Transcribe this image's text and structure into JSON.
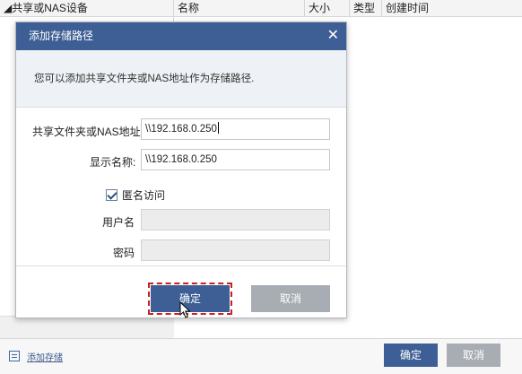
{
  "background": {
    "columns": [
      "◢共享或NAS设备",
      "名称",
      "大小",
      "类型",
      "创建时间"
    ],
    "add_storage_label": "添加存储",
    "ok_label": "确定",
    "cancel_label": "取消"
  },
  "dialog": {
    "title": "添加存储路径",
    "close_glyph": "✕",
    "description": "您可以添加共享文件夹或NAS地址作为存储路径.",
    "share_label": "共享文件夹或NAS地址:",
    "share_value": "\\\\192.168.0.250",
    "display_label": "显示名称:",
    "display_value": "\\\\192.168.0.250",
    "anonymous_label": "匿名访问",
    "anonymous_checked": true,
    "username_label": "用户名",
    "username_value": "",
    "password_label": "密码",
    "password_value": "",
    "ok_label": "确定",
    "cancel_label": "取消"
  },
  "colors": {
    "title_bar": "#3d5f95",
    "primary_button": "#3d5f95",
    "secondary_button": "#a8adb3",
    "highlight_outline": "#cc1f1f"
  },
  "icons": {
    "close": "close-icon",
    "checkbox": "checkbox-checked-icon",
    "add_storage": "list-icon",
    "cursor": "mouse-pointer-icon"
  }
}
